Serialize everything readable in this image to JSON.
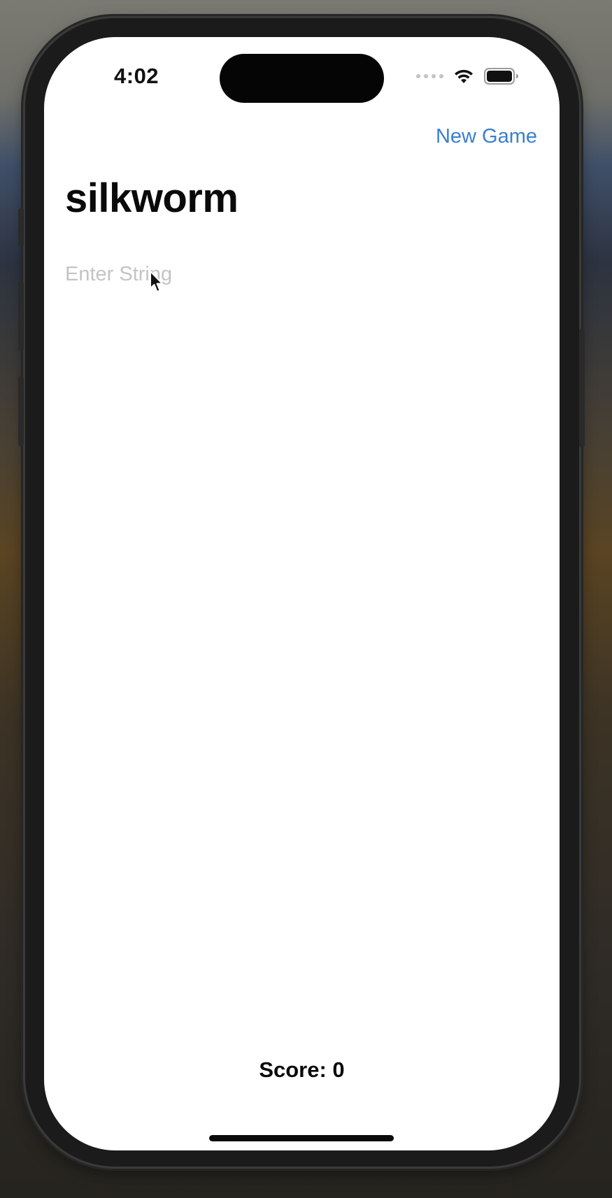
{
  "status_bar": {
    "time": "4:02",
    "cell_icon": "cellular-signal-icon",
    "wifi_icon": "wifi-icon",
    "battery_icon": "battery-icon"
  },
  "nav": {
    "new_game_label": "New Game"
  },
  "main": {
    "title": "silkworm",
    "input_placeholder": "Enter String",
    "input_value": ""
  },
  "footer": {
    "score_text": "Score: 0"
  },
  "colors": {
    "accent": "#3a7fce",
    "placeholder": "#c4c4c6",
    "text": "#0a0a0a"
  }
}
